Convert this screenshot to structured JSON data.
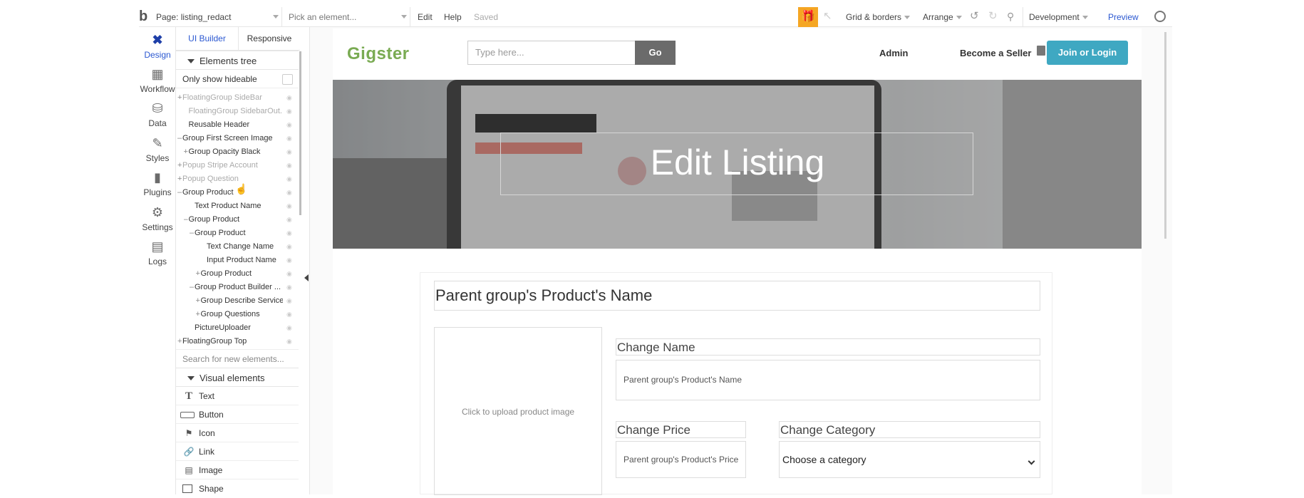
{
  "toolbar": {
    "page_label": "Page: listing_redact",
    "pick_element": "Pick an element...",
    "edit": "Edit",
    "help": "Help",
    "saved": "Saved",
    "grid_borders": "Grid & borders",
    "arrange": "Arrange",
    "environment": "Development",
    "preview": "Preview"
  },
  "rail": {
    "items": [
      {
        "label": "Design",
        "icon": "design-icon",
        "active": true
      },
      {
        "label": "Workflow",
        "icon": "workflow-icon"
      },
      {
        "label": "Data",
        "icon": "database-icon"
      },
      {
        "label": "Styles",
        "icon": "brush-icon"
      },
      {
        "label": "Plugins",
        "icon": "plug-icon"
      },
      {
        "label": "Settings",
        "icon": "gear-icon"
      },
      {
        "label": "Logs",
        "icon": "document-icon"
      }
    ]
  },
  "panel": {
    "tab_ui_builder": "UI Builder",
    "tab_responsive": "Responsive",
    "section_elements_tree": "Elements tree",
    "only_show_hideable": "Only show hideable",
    "tree": [
      {
        "prefix": "+",
        "label": "FloatingGroup SideBar",
        "dim": true,
        "indent": 0
      },
      {
        "prefix": "",
        "label": "FloatingGroup SidebarOut...",
        "dim": true,
        "indent": 1
      },
      {
        "prefix": "",
        "label": "Reusable Header",
        "indent": 1
      },
      {
        "prefix": "–",
        "label": "Group First Screen Image",
        "indent": 0
      },
      {
        "prefix": "+",
        "label": "Group Opacity Black",
        "indent": 1
      },
      {
        "prefix": "+",
        "label": "Popup Stripe Account",
        "dim": true,
        "indent": 0
      },
      {
        "prefix": "+",
        "label": "Popup Question",
        "dim": true,
        "indent": 0
      },
      {
        "prefix": "–",
        "label": "Group Product",
        "indent": 0
      },
      {
        "prefix": "",
        "label": "Text Product Name",
        "indent": 2
      },
      {
        "prefix": "–",
        "label": "Group Product",
        "indent": 1
      },
      {
        "prefix": "–",
        "label": "Group Product",
        "indent": 2
      },
      {
        "prefix": "",
        "label": "Text Change Name",
        "indent": 4
      },
      {
        "prefix": "",
        "label": "Input Product Name",
        "indent": 4
      },
      {
        "prefix": "+",
        "label": "Group Product",
        "indent": 3
      },
      {
        "prefix": "–",
        "label": "Group Product Builder ...",
        "indent": 2
      },
      {
        "prefix": "+",
        "label": "Group Describe Service",
        "indent": 3
      },
      {
        "prefix": "+",
        "label": "Group Questions",
        "indent": 3
      },
      {
        "prefix": "",
        "label": "PictureUploader",
        "indent": 2
      },
      {
        "prefix": "+",
        "label": "FloatingGroup Top",
        "indent": 0
      }
    ],
    "search_placeholder": "Search for new elements...",
    "section_visual": "Visual elements",
    "visual": [
      {
        "label": "Text",
        "icon": "text-icon"
      },
      {
        "label": "Button",
        "icon": "button-icon"
      },
      {
        "label": "Icon",
        "icon": "flag-icon"
      },
      {
        "label": "Link",
        "icon": "link-icon"
      },
      {
        "label": "Image",
        "icon": "image-icon"
      },
      {
        "label": "Shape",
        "icon": "shape-icon"
      }
    ]
  },
  "page": {
    "logo_text": "Gigster",
    "search_placeholder": "Type here...",
    "go": "Go",
    "admin": "Admin",
    "become_seller": "Become a Seller",
    "join_login": "Join or Login",
    "hero_title": "Edit Listing",
    "product_name_heading": "Parent group's Product's Name",
    "upload_text": "Click to upload product image",
    "change_name_label": "Change Name",
    "name_input_value": "Parent group's Product's Name",
    "change_price_label": "Change Price",
    "price_input_value": "Parent group's Product's Price",
    "change_category_label": "Change Category",
    "category_select": "Choose a category"
  },
  "colors": {
    "accent_blue": "#3fa8c2",
    "gift_orange": "#f5a623",
    "design_blue": "#1e3fa8",
    "logo_green": "#7aab53"
  }
}
